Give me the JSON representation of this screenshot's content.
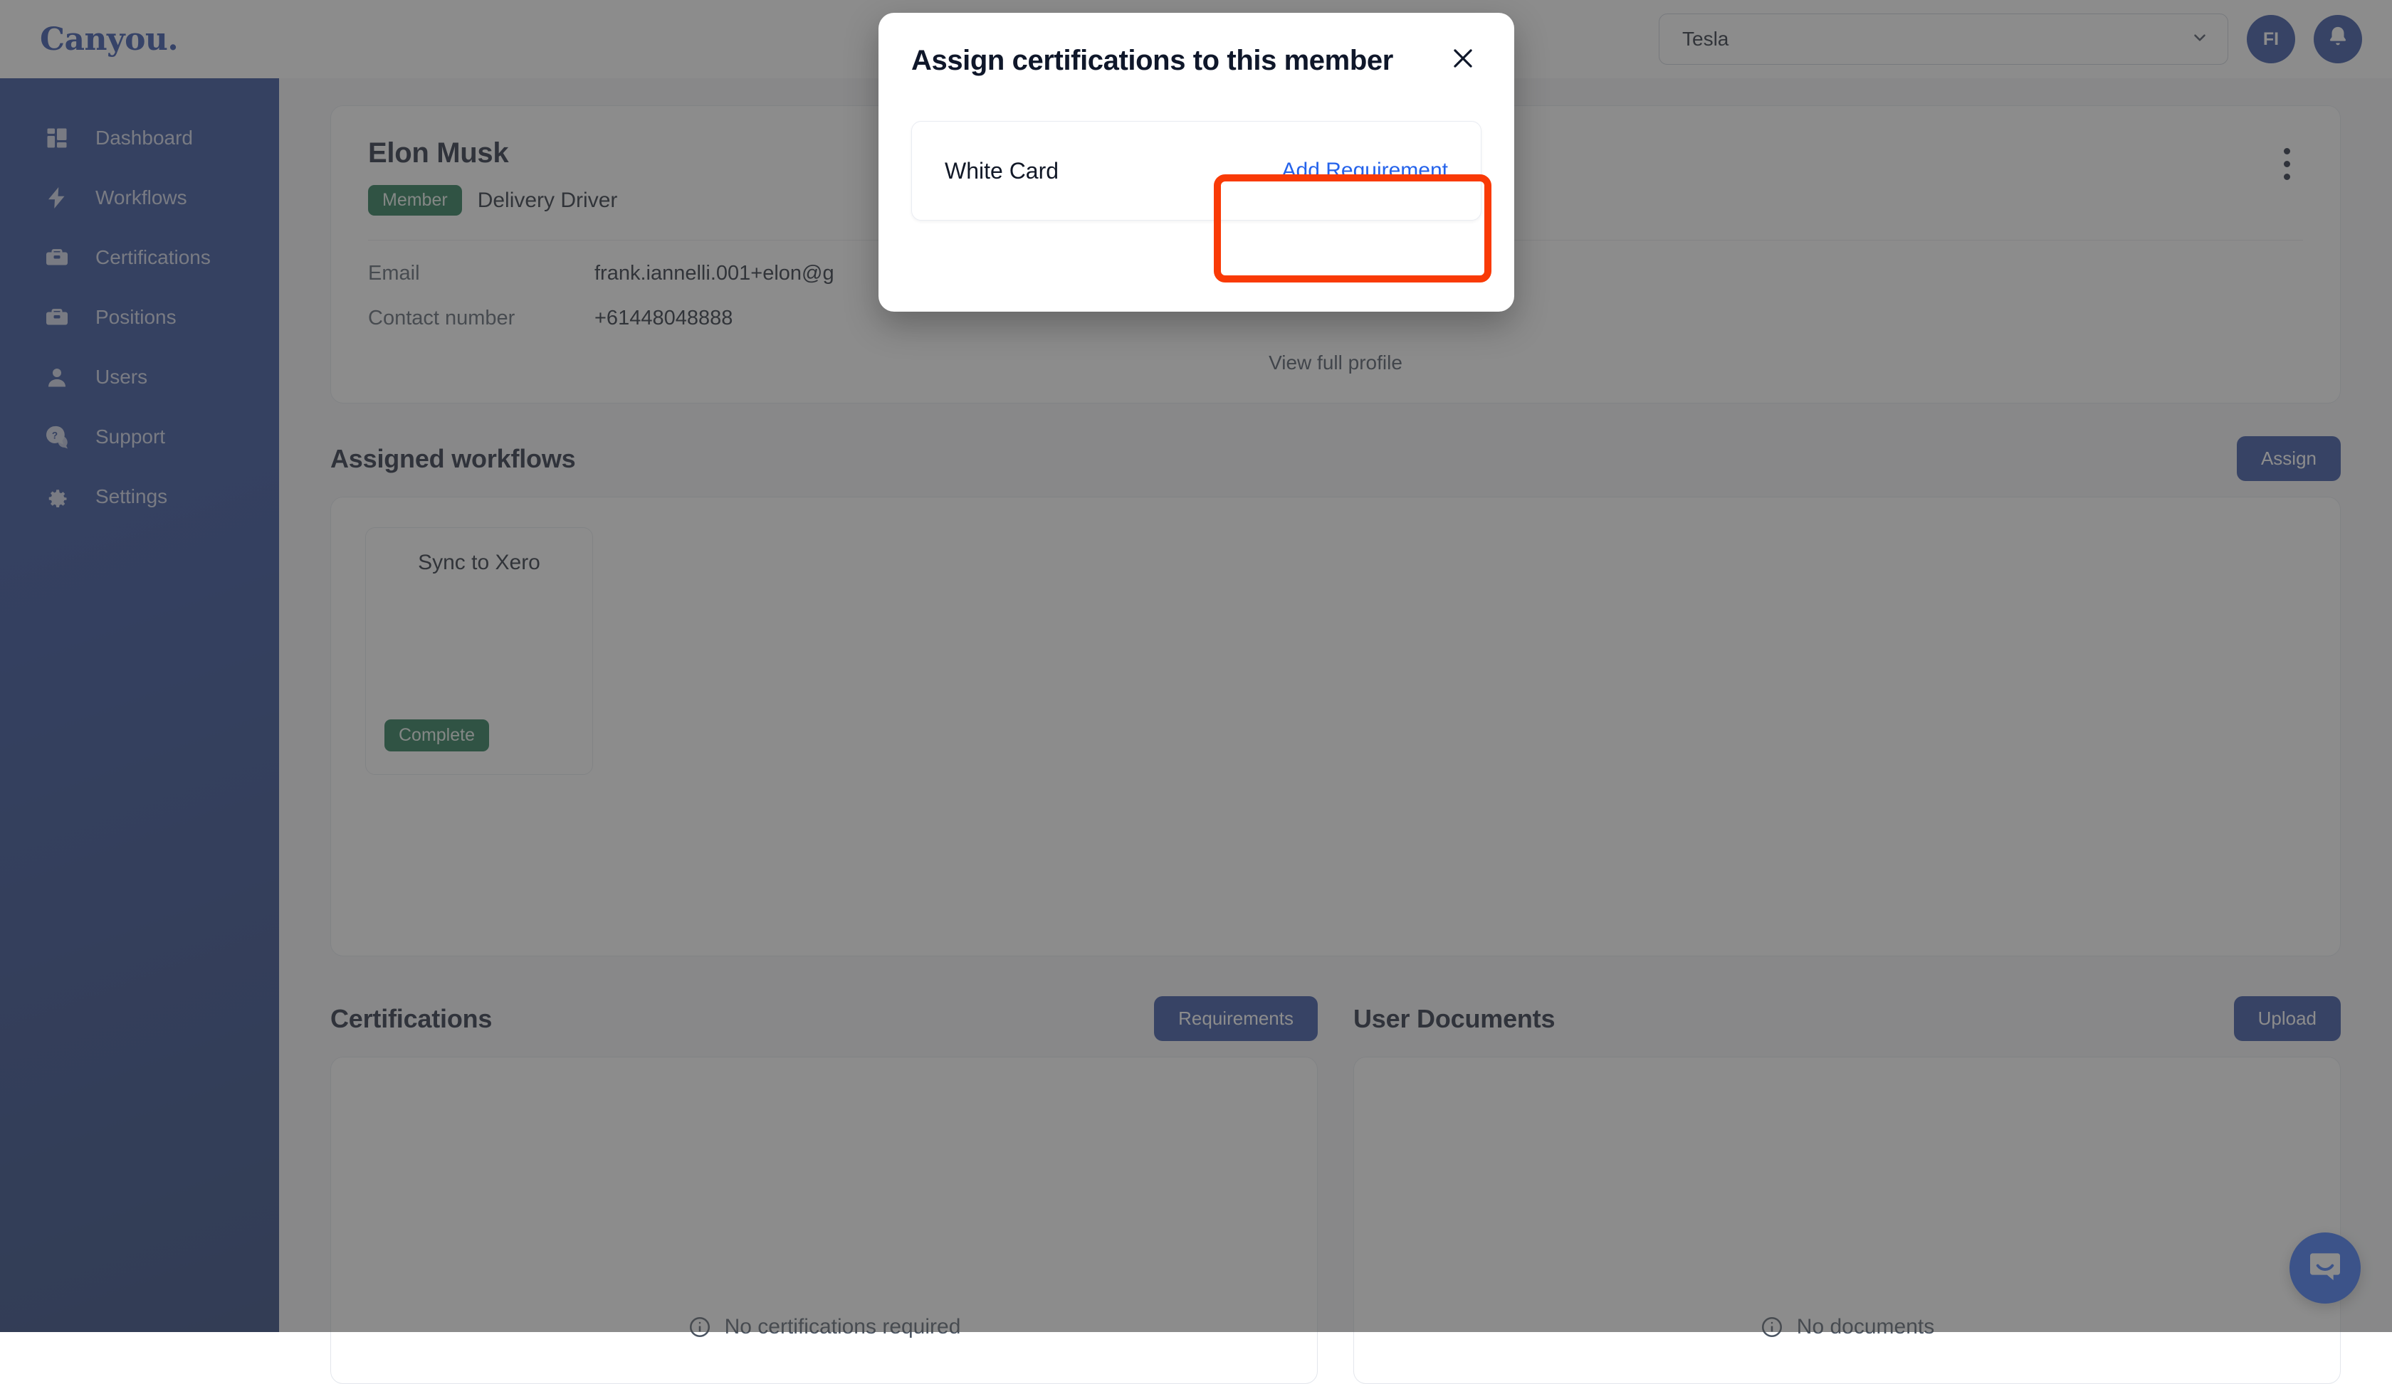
{
  "brand": {
    "name": "Canyou."
  },
  "sidebar": {
    "items": [
      {
        "label": "Dashboard",
        "icon": "dashboard-icon"
      },
      {
        "label": "Workflows",
        "icon": "lightning-icon"
      },
      {
        "label": "Certifications",
        "icon": "briefcase-icon"
      },
      {
        "label": "Positions",
        "icon": "briefcase-icon"
      },
      {
        "label": "Users",
        "icon": "user-icon"
      },
      {
        "label": "Support",
        "icon": "question-chat-icon"
      },
      {
        "label": "Settings",
        "icon": "gear-icon"
      }
    ]
  },
  "topbar": {
    "org_selected": "Tesla",
    "chevron": "⌄",
    "avatar_initials": "FI",
    "notifications_icon": "bell-icon"
  },
  "profile": {
    "name": "Elon Musk",
    "badge": "Member",
    "role": "Delivery Driver",
    "fields": [
      {
        "key": "Email",
        "value": "frank.iannelli.001+elon@g"
      },
      {
        "key": "Contact number",
        "value": "+61448048888"
      }
    ],
    "view_full_profile": "View full profile",
    "menu_icon": "kebab-menu-icon"
  },
  "workflows_section": {
    "title": "Assigned workflows",
    "assign_label": "Assign",
    "cards": [
      {
        "name": "Sync to Xero",
        "status": "Complete"
      }
    ]
  },
  "certifications_section": {
    "title": "Certifications",
    "action_label": "Requirements",
    "empty_text": "No certifications required",
    "empty_icon": "info-icon"
  },
  "documents_section": {
    "title": "User Documents",
    "action_label": "Upload",
    "empty_text": "No documents",
    "empty_icon": "info-icon"
  },
  "chat_widget": {
    "icon": "intercom-chat-icon"
  },
  "modal": {
    "title": "Assign certifications to this member",
    "close_icon": "close-icon",
    "rows": [
      {
        "name": "White Card",
        "action_label": "Add Requirement"
      }
    ]
  },
  "colors": {
    "sidebar": "#1b3a8f",
    "brand": "#1f3fa0",
    "primary_button": "#21409a",
    "link_blue": "#2563eb",
    "status_green": "#0f6b43",
    "highlight_red": "#f93a06",
    "chat_blue": "#2f6bf6"
  }
}
